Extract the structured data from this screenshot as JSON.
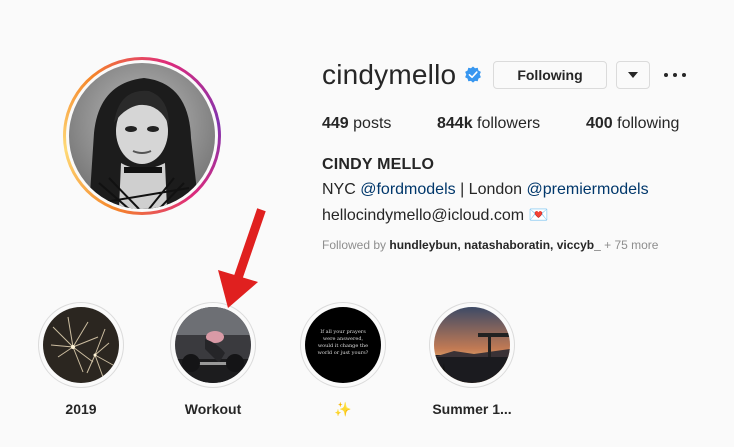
{
  "profile": {
    "username": "cindymello",
    "following_button": "Following",
    "stats": {
      "posts_count": "449",
      "posts_label": "posts",
      "followers_count": "844k",
      "followers_label": "followers",
      "following_count": "400",
      "following_label": "following"
    },
    "full_name": "CINDY MELLO",
    "bio": {
      "line1_prefix": "NYC ",
      "link1": "@fordmodels",
      "line1_middle": " | London ",
      "link2": "@premiermodels",
      "line2": "hellocindymello@icloud.com 💌"
    },
    "followed_by": {
      "prefix": "Followed by ",
      "users": "hundleybun, natashaboratin, viccyb_",
      "suffix": " + 75 more"
    }
  },
  "highlights": [
    {
      "label": "2019"
    },
    {
      "label": "Workout"
    },
    {
      "label": "✨",
      "story_text": "If all your prayers were answered, would it change the world or just yours?"
    },
    {
      "label": "Summer 1..."
    }
  ],
  "icons": [
    "verified-badge-icon",
    "chevron-down-icon",
    "more-options-icon",
    "red-arrow-annotation"
  ],
  "colors": {
    "verified": "#3897f0",
    "link": "#00376b",
    "annotation": "#e0201f"
  }
}
